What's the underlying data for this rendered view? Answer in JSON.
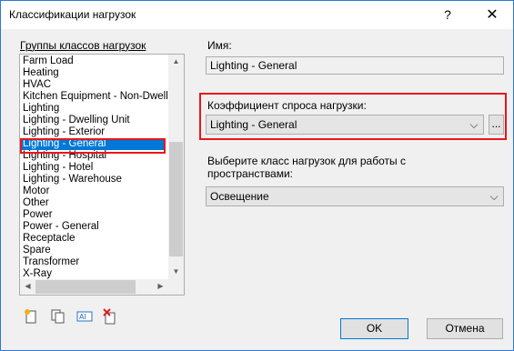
{
  "window": {
    "title": "Классификации нагрузок",
    "help_glyph": "?",
    "close_glyph": "✕"
  },
  "groups": {
    "label": "Группы классов нагрузок",
    "items": [
      "Farm Load",
      "Heating",
      "HVAC",
      "Kitchen Equipment - Non-Dwelling",
      "Lighting",
      "Lighting - Dwelling Unit",
      "Lighting - Exterior",
      "Lighting - General",
      "Lighting - Hospital",
      "Lighting - Hotel",
      "Lighting - Warehouse",
      "Motor",
      "Other",
      "Power",
      "Power - General",
      "Receptacle",
      "Spare",
      "Transformer",
      "X-Ray"
    ],
    "selected_index": 7
  },
  "name": {
    "label": "Имя:",
    "value": "Lighting - General"
  },
  "demand_factor": {
    "label": "Коэффициент спроса нагрузки:",
    "value": "Lighting - General",
    "browse_label": "..."
  },
  "space": {
    "label_line1": "Выберите класс нагрузок для работы с",
    "label_line2": "пространствами:",
    "value": "Освещение"
  },
  "buttons": {
    "ok": "OK",
    "cancel": "Отмена"
  },
  "colors": {
    "accent": "#0078d7",
    "highlight_border": "#e8161d"
  }
}
